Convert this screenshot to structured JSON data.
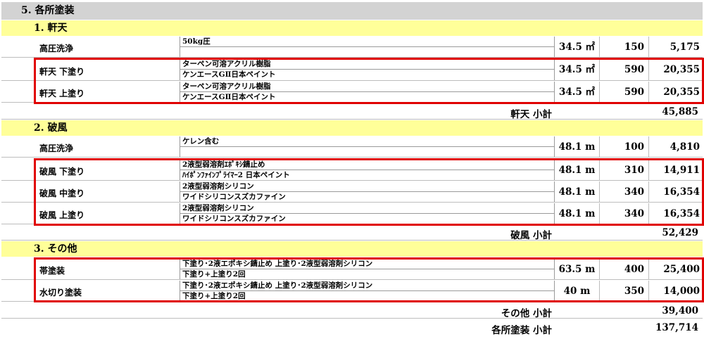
{
  "section_title": "5. 各所塗装",
  "groups": [
    {
      "title": "1. 軒天",
      "rows": [
        {
          "name": "高圧洗浄",
          "spec1": "50kg圧",
          "spec2": "",
          "qty": "34.5 ㎡",
          "price": "150",
          "amount": "5,175"
        },
        {
          "name": "軒天 下塗り",
          "spec1": "ターペン可溶アクリル樹脂",
          "spec2": "ケンエースGⅡ日本ペイント",
          "qty": "34.5 ㎡",
          "price": "590",
          "amount": "20,355"
        },
        {
          "name": "軒天 上塗り",
          "spec1": "ターペン可溶アクリル樹脂",
          "spec2": "ケンエースGⅡ日本ペイント",
          "qty": "34.5 ㎡",
          "price": "590",
          "amount": "20,355"
        }
      ],
      "subtotal_label": "軒天 小計",
      "subtotal": "45,885"
    },
    {
      "title": "2. 破風",
      "rows": [
        {
          "name": "高圧洗浄",
          "spec1": "ケレン含む",
          "spec2": "",
          "qty": "48.1 m",
          "price": "100",
          "amount": "4,810"
        },
        {
          "name": "破風 下塗り",
          "spec1": "2液型弱溶剤ｴﾎﾟｷｼ錆止め",
          "spec2": "ﾊｲﾎﾟﾝﾌｧｲﾝﾌﾟﾗｲﾏｰ2 日本ペイント",
          "qty": "48.1 m",
          "price": "310",
          "amount": "14,911"
        },
        {
          "name": "破風 中塗り",
          "spec1": "2液型弱溶剤シリコン",
          "spec2": "ワイドシリコンスズカファイン",
          "qty": "48.1 m",
          "price": "340",
          "amount": "16,354"
        },
        {
          "name": "破風 上塗り",
          "spec1": "2液型弱溶剤シリコン",
          "spec2": "ワイドシリコンスズカファイン",
          "qty": "48.1 m",
          "price": "340",
          "amount": "16,354"
        }
      ],
      "subtotal_label": "破風 小計",
      "subtotal": "52,429"
    },
    {
      "title": "3. その他",
      "rows": [
        {
          "name": "帯塗装",
          "spec1": "下塗り･2液エポキシ錆止め 上塗り･2液型弱溶剤シリコン",
          "spec2": "下塗り+上塗り2回",
          "qty": "63.5 m",
          "price": "400",
          "amount": "25,400"
        },
        {
          "name": "水切り塗装",
          "spec1": "下塗り･2液エポキシ錆止め 上塗り･2液型弱溶剤シリコン",
          "spec2": "下塗り+上塗り2回",
          "qty": "40 m",
          "price": "350",
          "amount": "14,000"
        }
      ],
      "subtotal_label": "その他 小計",
      "subtotal": "39,400"
    }
  ],
  "grand_total_label": "各所塗装 小計",
  "grand_total": "137,714",
  "highlight_color": "#e00000"
}
